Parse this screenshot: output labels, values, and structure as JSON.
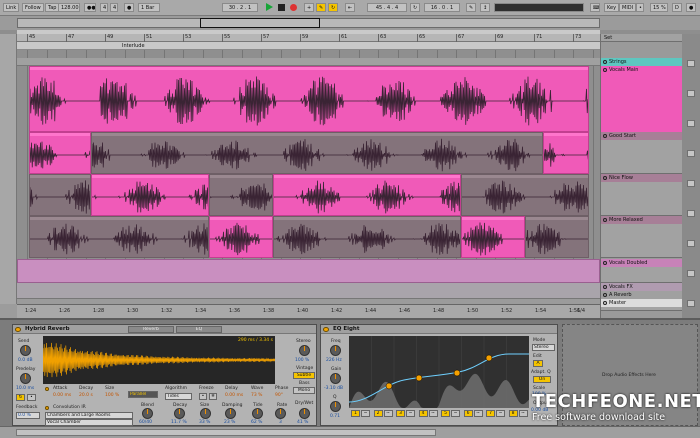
{
  "transport": {
    "link": "Link",
    "follow": "Follow",
    "tap": "Tap",
    "tempo": "128.00",
    "sig_num": "4",
    "sig_den": "4",
    "quant": "1 Bar",
    "position": "30 . 2 . 1",
    "loop_start": "45 . 4 . 4",
    "loop_len": "16 . 0 . 1",
    "key": "Key",
    "midi": "MIDI",
    "cpu": "15 %",
    "d_label": "D"
  },
  "ruler": {
    "bars": [
      "45",
      "47",
      "49",
      "51",
      "53",
      "55",
      "57",
      "59",
      "61",
      "63",
      "65",
      "67",
      "69",
      "71",
      "73"
    ],
    "locator": "Interlude",
    "set_label": "Set"
  },
  "timeline": {
    "times": [
      "1:24",
      "1:26",
      "1:28",
      "1:30",
      "1:32",
      "1:34",
      "1:36",
      "1:38",
      "1:40",
      "1:42",
      "1:44",
      "1:46",
      "1:48",
      "1:50",
      "1:52",
      "1:54",
      "1:56"
    ],
    "zoom": "1/4"
  },
  "tracks": [
    {
      "name": "Strings",
      "color": "#5ec7c0"
    },
    {
      "name": "Vocals Main",
      "color": "#f05ab8"
    },
    {
      "name": "Good Start",
      "color": "#a77f97"
    },
    {
      "name": "Nice Flow",
      "color": "#a77f97"
    },
    {
      "name": "More Relaxed",
      "color": "#a77f97"
    },
    {
      "name": "Vocals Doubled",
      "color": "#c782b8"
    },
    {
      "name": "Vocals FX",
      "color": "#b09bb0"
    },
    {
      "name": "A Reverb",
      "color": "#a0a0a0"
    },
    {
      "name": "Master",
      "color": "#dcdcdc"
    }
  ],
  "reverb": {
    "title": "Hybrid Reverb",
    "tab_reverb": "Reverb",
    "tab_eq": "EQ",
    "send_label": "Send",
    "send_val": "0.0 dB",
    "predelay_label": "Predelay",
    "predelay_val": "10.0 ms",
    "feedback_label": "Feedback",
    "feedback_val": "0.0 %",
    "ir_info": "290 ms / 3.34 s",
    "attack_label": "Attack",
    "attack_val": "0.00 ms",
    "decay_label": "Decay",
    "decay_val": "20.0 s",
    "size_label": "Size",
    "size_val": "100 %",
    "routing_val": "Parallel",
    "algorithm_label": "Algorithm",
    "algorithm_val": "Tides",
    "freeze_label": "Freeze",
    "delay_label": "Delay",
    "delay_val": "0.00 ms",
    "wave_label": "Wave",
    "wave_val": "73 %",
    "phase_label": "Phase",
    "phase_val": "90°",
    "stereo_label": "Stereo",
    "stereo_val": "100 %",
    "vintage_label": "Vintage",
    "vintage_val": "Subtle",
    "bass_label": "Bass",
    "bass_val": "Mono",
    "convolution_label": "Convolution IR",
    "ir_category": "Chambers and Large Rooms",
    "ir_name": "Vocal Chamber",
    "blend_label": "Blend",
    "blend_val": "60/40",
    "decay2_label": "Decay",
    "decay2_val": "11.7 %",
    "size2_label": "Size",
    "size2_val": "33 %",
    "damping_label": "Damping",
    "damping_val": "23 %",
    "tide_label": "Tide",
    "tide_val": "62 %",
    "rate_label": "Rate",
    "rate_val": "3",
    "drywet_label": "Dry/Wet",
    "drywet_val": "41 %"
  },
  "eq": {
    "title": "EQ Eight",
    "freq_label": "Freq",
    "freq_val": "226 Hz",
    "gain_label": "Gain",
    "gain_val": "-3.10 dB",
    "q_label": "Q",
    "q_val": "0.71",
    "mode_label": "Mode",
    "mode_val": "Stereo",
    "edit_label": "Edit",
    "adapt_label": "Adapt. Q",
    "adapt_val": "On",
    "scale_label": "Scale",
    "scale_val": "100 %",
    "output_label": "Output",
    "output_val": "0.00 dB",
    "bands": [
      "1",
      "2",
      "3",
      "4",
      "5",
      "6",
      "7",
      "8"
    ]
  },
  "drop_zone": "Drop Audio Effects Here",
  "watermark": {
    "line1": "TECHFEONE.NET",
    "line2": "Free software download site"
  }
}
